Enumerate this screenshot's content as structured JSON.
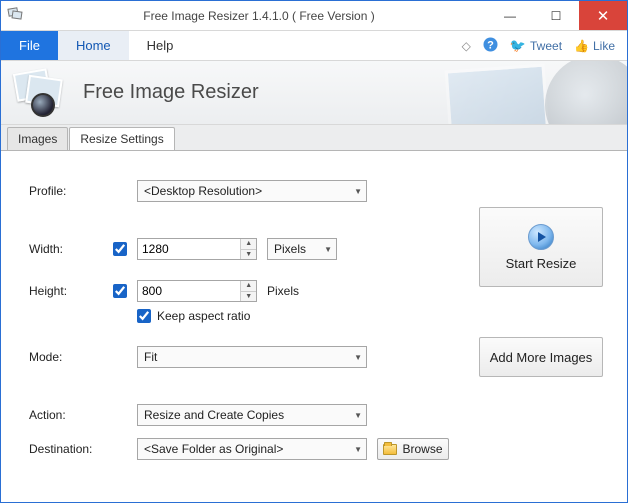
{
  "window": {
    "title": "Free Image Resizer 1.4.1.0 ( Free Version )"
  },
  "menu": {
    "file": "File",
    "home": "Home",
    "help": "Help",
    "tweet": "Tweet",
    "like": "Like"
  },
  "banner": {
    "app_title": "Free Image Resizer"
  },
  "tabs": {
    "images": "Images",
    "resize_settings": "Resize Settings"
  },
  "form": {
    "profile_label": "Profile:",
    "profile_value": "<Desktop Resolution>",
    "width_label": "Width:",
    "width_value": "1280",
    "width_unit": "Pixels",
    "width_enabled": true,
    "height_label": "Height:",
    "height_value": "800",
    "height_unit": "Pixels",
    "height_enabled": true,
    "keep_aspect_label": "Keep aspect ratio",
    "keep_aspect_checked": true,
    "mode_label": "Mode:",
    "mode_value": "Fit",
    "action_label": "Action:",
    "action_value": "Resize and Create Copies",
    "destination_label": "Destination:",
    "destination_value": "<Save Folder as Original>",
    "browse_label": "Browse"
  },
  "buttons": {
    "start_resize": "Start Resize",
    "add_more": "Add More Images"
  }
}
